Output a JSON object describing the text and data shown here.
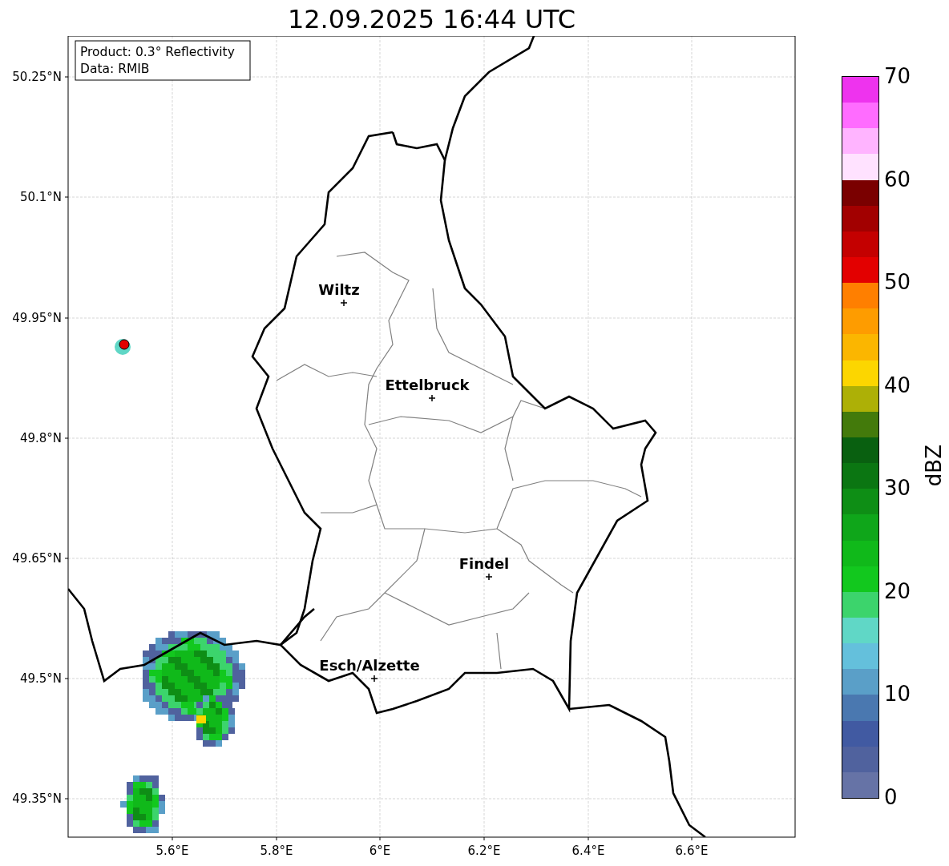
{
  "title": "12.09.2025 16:44 UTC",
  "info_box": [
    "Product: 0.3° Reflectivity",
    "Data: RMIB"
  ],
  "y_ticks": [
    "50.25°N",
    "50.1°N",
    "49.95°N",
    "49.8°N",
    "49.65°N",
    "49.5°N",
    "49.35°N"
  ],
  "x_ticks": [
    "5.6°E",
    "5.8°E",
    "6°E",
    "6.2°E",
    "6.4°E",
    "6.6°E"
  ],
  "cities": [
    {
      "name": "Wiltz"
    },
    {
      "name": "Ettelbruck"
    },
    {
      "name": "Findel"
    },
    {
      "name": "Esch/Alzette"
    }
  ],
  "colorbar": {
    "label": "dBZ",
    "ticks": [
      "70",
      "60",
      "50",
      "40",
      "30",
      "20",
      "10",
      "0"
    ],
    "bins": [
      {
        "color": "#6673a6"
      },
      {
        "color": "#50629e"
      },
      {
        "color": "#415aa2"
      },
      {
        "color": "#4a78b0"
      },
      {
        "color": "#5a9fc8"
      },
      {
        "color": "#64c0dc"
      },
      {
        "color": "#60d7c6"
      },
      {
        "color": "#3cd46c"
      },
      {
        "color": "#12c81e"
      },
      {
        "color": "#10b91a"
      },
      {
        "color": "#0fa61a"
      },
      {
        "color": "#0e8e15"
      },
      {
        "color": "#0b7612"
      },
      {
        "color": "#096010"
      },
      {
        "color": "#437a0b"
      },
      {
        "color": "#adb006"
      },
      {
        "color": "#fcd600"
      },
      {
        "color": "#fbb600"
      },
      {
        "color": "#fe9c00"
      },
      {
        "color": "#ff7f00"
      },
      {
        "color": "#e30000"
      },
      {
        "color": "#c40000"
      },
      {
        "color": "#a20000"
      },
      {
        "color": "#7a0000"
      },
      {
        "color": "#ffe2ff"
      },
      {
        "color": "#ffb4ff"
      },
      {
        "color": "#ff6cff"
      },
      {
        "color": "#ee33ee"
      }
    ]
  }
}
